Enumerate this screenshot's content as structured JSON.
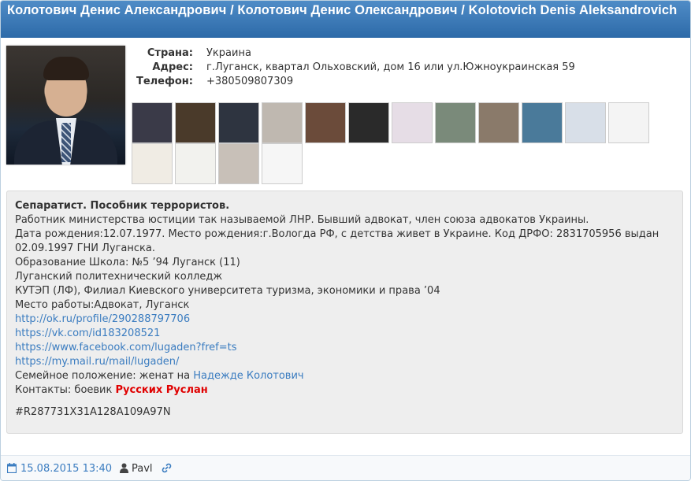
{
  "header": {
    "title": "Колотович Денис Александрович / Колотович Денис Олександрович / Kolotovich Denis Aleksandrovich"
  },
  "profile": {
    "photo_alt": "portrait photo",
    "fields": [
      {
        "label": "Страна:",
        "value": "Украина"
      },
      {
        "label": "Адрес:",
        "value": "г.Луганск, квартал Ольховский, дом 16 или ул.Южноукраинская 59"
      },
      {
        "label": "Телефон:",
        "value": "+380509807309"
      }
    ],
    "thumbnails": [
      {
        "name": "photo-1",
        "color": "#3a3a48"
      },
      {
        "name": "photo-2",
        "color": "#4a3a2a"
      },
      {
        "name": "photo-3",
        "color": "#2e3440"
      },
      {
        "name": "document-scan",
        "color": "#bfb8b0"
      },
      {
        "name": "news-photo",
        "color": "#6b4b3a"
      },
      {
        "name": "tv-screenshot",
        "color": "#2a2a2a"
      },
      {
        "name": "social-post",
        "color": "#e6dde6"
      },
      {
        "name": "group-photo",
        "color": "#7a8a7a"
      },
      {
        "name": "people-photo",
        "color": "#8a7a6a"
      },
      {
        "name": "news-screenshot",
        "color": "#4a7a9a"
      },
      {
        "name": "profile-page",
        "color": "#d8dfe8"
      },
      {
        "name": "text-document",
        "color": "#f4f4f4"
      },
      {
        "name": "web-page",
        "color": "#f0ece4"
      },
      {
        "name": "text-snippet",
        "color": "#f2f2ee"
      },
      {
        "name": "meeting-photo",
        "color": "#c8c0b8"
      },
      {
        "name": "site-screenshot",
        "color": "#f6f6f6"
      }
    ]
  },
  "description": {
    "headline": "Сепаратист. Пособник террористов.",
    "lines": [
      "Работник министерства юстиции так называемой ЛНР. Бывший адвокат, член союза адвокатов Украины.",
      "Дата рождения:12.07.1977. Место рождения:г.Вологда РФ, с детства живет в Украине. Код ДРФО: 2831705956 выдан",
      "02.09.1997 ГНИ Луганска.",
      "Образование Школа: №5 ’94 Луганск (11)",
      "Луганский политехнический колледж",
      "КУТЭП (ЛФ), Филиал Киевского университета туризма, экономики и права ’04",
      "Место работы:Адвокат, Луганск"
    ],
    "links": [
      "http://ok.ru/profile/290288797706",
      "https://vk.com/id183208521",
      "https://www.facebook.com/lugaden?fref=ts",
      "https://my.mail.ru/mail/lugaden/"
    ],
    "family_prefix": "Семейное положение: женат на ",
    "family_link": "Надежде Колотович",
    "contacts_prefix": "Контакты: боевик ",
    "contacts_link": "Русских Руслан",
    "hash": "#R287731X31A128A109A97N"
  },
  "footer": {
    "date": "15.08.2015 13:40",
    "author": "Pavl"
  },
  "colors": {
    "header_top": "#4f8cc7",
    "header_bottom": "#2d6aa8",
    "link": "#3a7cc0",
    "red_link": "#e00000",
    "desc_bg": "#eeeeee"
  }
}
